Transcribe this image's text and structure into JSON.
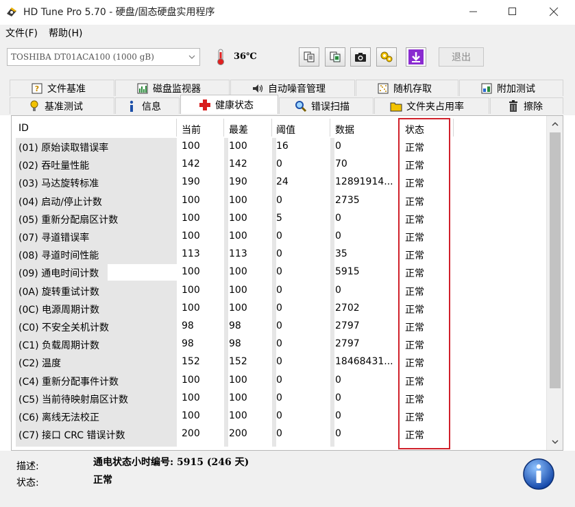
{
  "window": {
    "title": "HD Tune Pro 5.70 - 硬盘/固态硬盘实用程序"
  },
  "menu": [
    {
      "label": "文件(F)"
    },
    {
      "label": "帮助(H)"
    }
  ],
  "toolbar": {
    "drive": "TOSHIBA DT01ACA100 (1000 gB)",
    "temperature": "36℃",
    "exit_label": "退出"
  },
  "tabs_row1": [
    {
      "label": "文件基准",
      "icon": "file-benchmark-icon"
    },
    {
      "label": "磁盘监视器",
      "icon": "disk-monitor-icon"
    },
    {
      "label": "自动噪音管理",
      "icon": "speaker-icon"
    },
    {
      "label": "随机存取",
      "icon": "random-access-icon"
    },
    {
      "label": "附加测试",
      "icon": "extra-tests-icon"
    }
  ],
  "tabs_row2": [
    {
      "label": "基准测试",
      "icon": "benchmark-icon"
    },
    {
      "label": "信息",
      "icon": "info-icon"
    },
    {
      "label": "健康状态",
      "icon": "health-cross-icon"
    },
    {
      "label": "错误扫描",
      "icon": "magnifier-icon"
    },
    {
      "label": "文件夹占用率",
      "icon": "folder-icon"
    },
    {
      "label": "擦除",
      "icon": "trash-icon"
    }
  ],
  "table": {
    "columns": [
      "ID",
      "当前",
      "最差",
      "阈值",
      "数据",
      "状态"
    ],
    "rows": [
      [
        "(01) 原始读取错误率",
        "100",
        "100",
        "16",
        "0",
        "正常"
      ],
      [
        "(02) 吞吐量性能",
        "142",
        "142",
        "0",
        "70",
        "正常"
      ],
      [
        "(03) 马达旋转标准",
        "190",
        "190",
        "24",
        "12891914...",
        "正常"
      ],
      [
        "(04) 启动/停止计数",
        "100",
        "100",
        "0",
        "2735",
        "正常"
      ],
      [
        "(05) 重新分配扇区计数",
        "100",
        "100",
        "5",
        "0",
        "正常"
      ],
      [
        "(07) 寻道错误率",
        "100",
        "100",
        "0",
        "0",
        "正常"
      ],
      [
        "(08) 寻道时间性能",
        "113",
        "113",
        "0",
        "35",
        "正常"
      ],
      [
        "(09) 通电时间计数",
        "100",
        "100",
        "0",
        "5915",
        "正常"
      ],
      [
        "(0A) 旋转重试计数",
        "100",
        "100",
        "0",
        "0",
        "正常"
      ],
      [
        "(0C) 电源周期计数",
        "100",
        "100",
        "0",
        "2702",
        "正常"
      ],
      [
        "(C0) 不安全关机计数",
        "98",
        "98",
        "0",
        "2797",
        "正常"
      ],
      [
        "(C1) 负载周期计数",
        "98",
        "98",
        "0",
        "2797",
        "正常"
      ],
      [
        "(C2) 温度",
        "152",
        "152",
        "0",
        "18468431...",
        "正常"
      ],
      [
        "(C4) 重新分配事件计数",
        "100",
        "100",
        "0",
        "0",
        "正常"
      ],
      [
        "(C5) 当前待映射扇区计数",
        "100",
        "100",
        "0",
        "0",
        "正常"
      ],
      [
        "(C6) 离线无法校正",
        "100",
        "100",
        "0",
        "0",
        "正常"
      ],
      [
        "(C7) 接口 CRC 错误计数",
        "200",
        "200",
        "0",
        "0",
        "正常"
      ]
    ]
  },
  "bottom": {
    "desc_label": "描述:",
    "desc_value": "通电状态小时编号: 5915 (246 天)",
    "state_label": "状态:",
    "state_value": "正常"
  },
  "colors": {
    "highlight_border": "#d0202a",
    "shade": "#e6e6e6"
  }
}
